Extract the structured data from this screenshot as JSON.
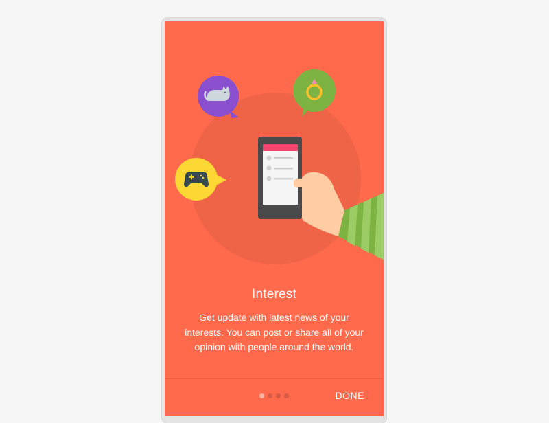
{
  "onboarding": {
    "title": "Interest",
    "description": "Get update with latest news of your interests. You can post or share all of your opinion with people around the world.",
    "done_label": "DONE",
    "page_indicator": {
      "total": 4,
      "current": 1
    }
  },
  "illustration": {
    "bubbles": [
      {
        "icon": "cat-icon",
        "color": "#8a4fce"
      },
      {
        "icon": "ring-icon",
        "color": "#7cb342"
      },
      {
        "icon": "gamepad-icon",
        "color": "#fdd835"
      }
    ]
  },
  "colors": {
    "background": "#ff6a4d",
    "circle": "#ef6346",
    "phone_header": "#f0466f"
  }
}
